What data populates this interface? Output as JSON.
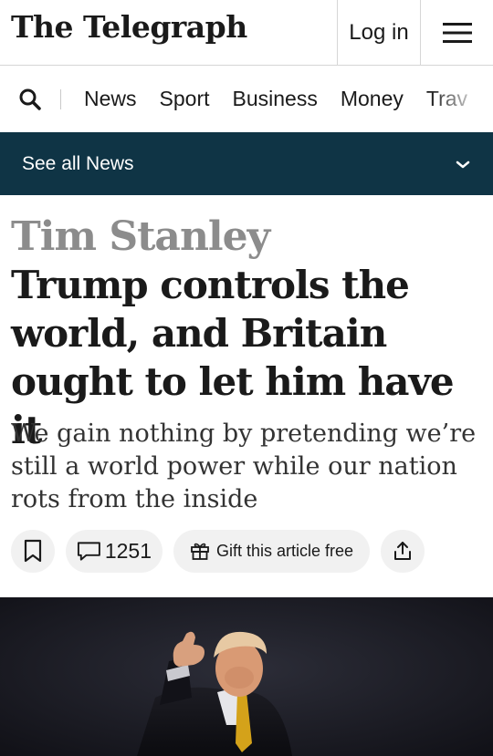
{
  "header": {
    "logo_text": "The Telegraph",
    "login_label": "Log in",
    "menu_icon": "hamburger-menu-icon"
  },
  "nav": {
    "search_icon": "search-icon",
    "items": [
      {
        "label": "News"
      },
      {
        "label": "Sport"
      },
      {
        "label": "Business"
      },
      {
        "label": "Money"
      },
      {
        "label": "Trav"
      }
    ]
  },
  "section_bar": {
    "label": "See all News",
    "chevron_icon": "chevron-down-icon"
  },
  "article": {
    "author": "Tim Stanley",
    "headline": "Trump controls the world, and Britain ought to let him have it",
    "standfirst": "We gain nothing by pretending we’re still a world power while our nation rots from the inside",
    "actions": {
      "bookmark_icon": "bookmark-icon",
      "comment_icon": "comment-icon",
      "comment_count": "1251",
      "gift_icon": "gift-icon",
      "gift_label": "Gift this article free",
      "share_icon": "share-icon"
    },
    "hero_image": "photo of man giving thumbs up in dark setting"
  },
  "colors": {
    "section_bar_bg": "#0f3445",
    "author_grey": "#8c8c8c",
    "pill_bg": "#f1f1f1"
  }
}
